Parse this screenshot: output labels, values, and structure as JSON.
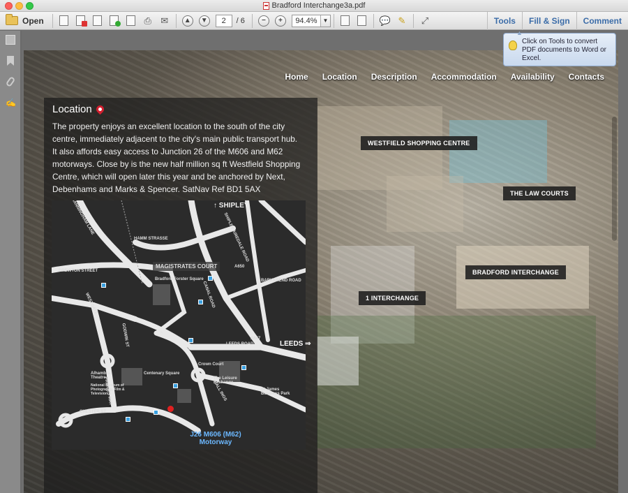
{
  "window": {
    "title": "Bradford Interchange3a.pdf"
  },
  "toolbar": {
    "open_label": "Open",
    "page_current": "2",
    "page_separator": "/",
    "page_total": "6",
    "zoom": "94.4%",
    "zoom_out": "−",
    "zoom_in": "+",
    "tools_label": "Tools",
    "fill_sign_label": "Fill & Sign",
    "comment_label": "Comment"
  },
  "tooltip": {
    "text": "Click on Tools to convert PDF documents to Word or Excel."
  },
  "page_nav": [
    "Home",
    "Location",
    "Description",
    "Accommodation",
    "Availability",
    "Contacts"
  ],
  "location": {
    "title": "Location",
    "body": "The property enjoys an excellent location to the south of the city centre, immediately adjacent to the city's main public transport hub. It also affords easy access to Junction 26 of the M606 and M62 motorways. Close by is the new half million sq ft Westfield Shopping Centre, which will open later this year and be anchored by Next, Debenhams and Marks & Spencer. SatNav Ref BD1 5AX"
  },
  "map": {
    "shipley": "↑ SHIPLEY",
    "magistrates": "MAGISTRATES COURT",
    "leeds": "LEEDS ⇒",
    "motorway": "J26 M606 (M62) Motorway",
    "streets": [
      "MANNINGHAM LANE",
      "HAMM STRASSE",
      "DREWTON STREET",
      "SHIPLEY AIREDALE ROAD",
      "CANAL ROAD",
      "BARKEREND ROAD",
      "LEEDS ROAD",
      "HALL INGS",
      "PRINCES WAY",
      "CHESTER ST",
      "WESTGATE",
      "GODWIN ST",
      "A647",
      "A650"
    ],
    "places": [
      "Bradford Forster Square",
      "Alhambra Theatre",
      "National Museum of Photography, Film & Television",
      "Centenary Square",
      "Crown Court",
      "The Leisure Exchange",
      "St James Business Park"
    ]
  },
  "callouts": {
    "westfield": "WESTFIELD SHOPPING CENTRE",
    "law_courts": "THE LAW COURTS",
    "interchange": "BRADFORD INTERCHANGE",
    "one_interchange": "1 INTERCHANGE"
  }
}
